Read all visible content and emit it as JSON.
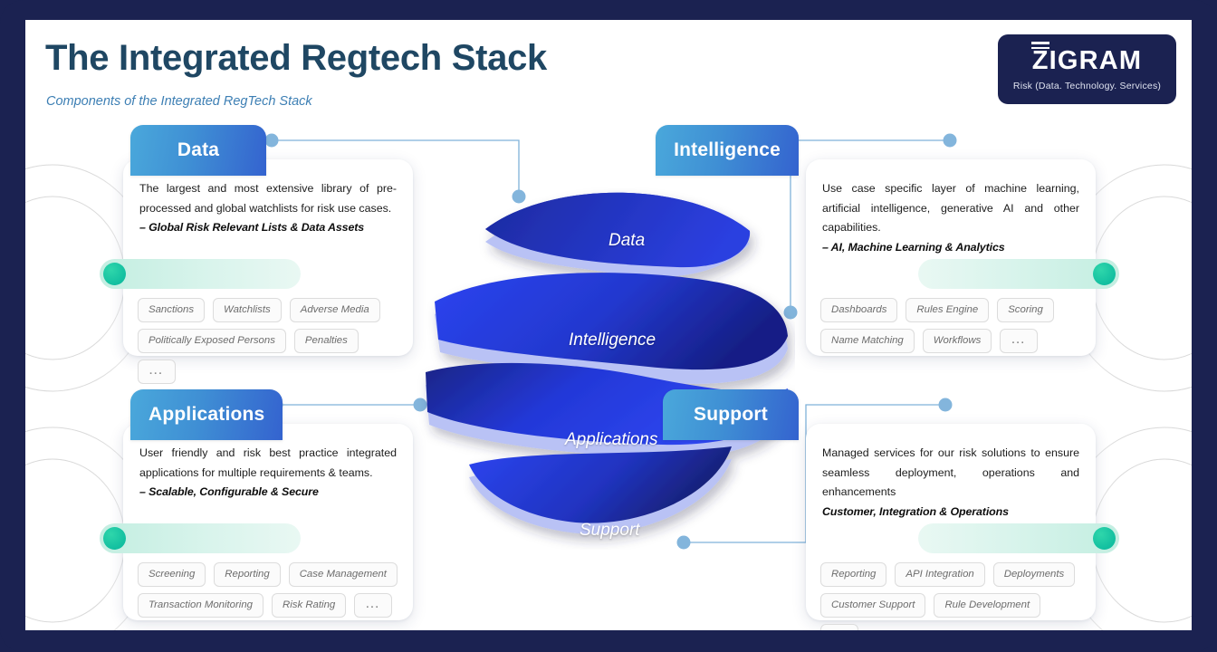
{
  "header": {
    "title": "The Integrated Regtech Stack",
    "subtitle": "Components of the Integrated RegTech Stack"
  },
  "logo": {
    "name": "ZIGRAM",
    "tagline": "Risk (Data. Technology. Services)"
  },
  "colors": {
    "frame_navy": "#1b2251",
    "title_blue": "#1f4763",
    "subtitle_blue": "#3d7fb4",
    "tab_gradient_start": "#4aa8db",
    "tab_gradient_end": "#3463cf",
    "connector_blue": "#7fb2d9",
    "teal_dot": "#12bfa0",
    "pill_mint": "#c3eee1",
    "band_light": "#b9c2f5",
    "band_mid": "#2b44e8",
    "band_dark": "#1b2b9e"
  },
  "sphere": {
    "bands": [
      {
        "label": "Data"
      },
      {
        "label": "Intelligence"
      },
      {
        "label": "Applications"
      },
      {
        "label": "Support"
      }
    ]
  },
  "cards": [
    {
      "id": "data",
      "title": "Data",
      "description": "The largest and most extensive library of pre-processed and global watchlists for risk use cases.",
      "tagline": "– Global Risk Relevant Lists & Data Assets",
      "chips": [
        "Sanctions",
        "Watchlists",
        "Adverse Media",
        "Politically Exposed Persons",
        "Penalties",
        "..."
      ]
    },
    {
      "id": "intelligence",
      "title": "Intelligence",
      "description": "Use case specific layer of machine learning, artificial intelligence, generative AI and other capabilities.",
      "tagline": "– AI, Machine Learning & Analytics",
      "chips": [
        "Dashboards",
        "Rules Engine",
        "Scoring",
        "Name Matching",
        "Workflows",
        "..."
      ]
    },
    {
      "id": "applications",
      "title": "Applications",
      "description": "User friendly and risk best practice integrated applications for multiple requirements & teams.",
      "tagline": "– Scalable, Configurable & Secure",
      "chips": [
        "Screening",
        "Reporting",
        "Case Management",
        "Transaction Monitoring",
        "Risk Rating",
        "..."
      ]
    },
    {
      "id": "support",
      "title": "Support",
      "description": "Managed services for our risk solutions to ensure seamless deployment, operations and enhancements",
      "tagline": "Customer, Integration & Operations",
      "chips": [
        "Reporting",
        "API Integration",
        "Deployments",
        "Customer Support",
        "Rule Development",
        "..."
      ]
    }
  ]
}
